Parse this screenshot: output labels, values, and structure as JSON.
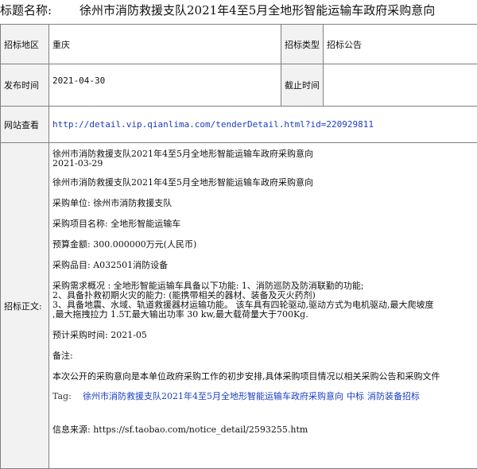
{
  "header": {
    "label": "标题名称:",
    "title": "徐州市消防救援支队2021年4至5月全地形智能运输车政府采购意向"
  },
  "fields": {
    "region_label": "招标地区",
    "region_value": "重庆",
    "type_label": "招标类型",
    "type_value": "招标公告",
    "publish_label": "发布时间",
    "publish_value": "2021-04-30",
    "deadline_label": "截止时间",
    "deadline_value": "",
    "web_label": "网站查看",
    "web_url": "http://detail.vip.qianlima.com/tenderDetail.html?id=220929811",
    "body_label": "招标正文:"
  },
  "body": {
    "heading": "徐州市消防救援支队2021年4至5月全地形智能运输车政府采购意向",
    "date": "2021-03-29",
    "heading2": "徐州市消防救援支队2021年4至5月全地形智能运输车政府采购意向",
    "unit": "采购单位: 徐州市消防救援支队",
    "project": "采购项目名称: 全地形智能运输车",
    "budget": "预算金额: 300.000000万元(人民币)",
    "item": "采购品目: A032501消防设备",
    "needs": [
      "采购需求概况 : 全地形智能运输车具备以下功能: 1、消防巡防及防消联勤的功能;",
      "2、具备扑救初期火灾的能力: (能携带相关的器材、装备及灭火药剂)",
      "3、具备地震、水域、轨道救援器材运输功能。 该车具有四轮驱动,驱动方式为电机驱动,最大爬坡度",
      ",最大拖拽拉力 1.5T,最大输出功率 30 kw,最大载荷量大于700Kg."
    ],
    "time": "预计采购时间: 2021-05",
    "remark_label": "备注:",
    "remark": "本次公开的采购意向是本单位政府采购工作的初步安排,具体采购项目情况以相关采购公告和采购文件",
    "tag_label": "Tag:",
    "tags": [
      "徐州市消防救援支队2021年4至5月全地形智能运输车政府采购意向",
      "中标",
      "消防装备招标"
    ],
    "source": "信息来源: https://sf.taobao.com/notice_detail/2593255.htm"
  }
}
